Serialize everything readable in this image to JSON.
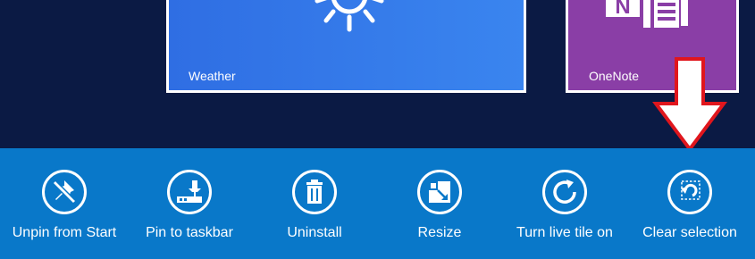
{
  "tiles": [
    {
      "label": "Weather",
      "icon": "sun-icon",
      "color": "#3a85ef"
    },
    {
      "label": "OneNote",
      "icon": "onenote-icon",
      "color": "#8a3ea6"
    }
  ],
  "app_bar": {
    "color": "#0978c9",
    "commands": [
      {
        "label": "Unpin from Start",
        "icon": "unpin-icon"
      },
      {
        "label": "Pin to taskbar",
        "icon": "pin-taskbar-icon"
      },
      {
        "label": "Uninstall",
        "icon": "trash-icon"
      },
      {
        "label": "Resize",
        "icon": "resize-icon"
      },
      {
        "label": "Turn live tile on",
        "icon": "refresh-icon"
      },
      {
        "label": "Clear selection",
        "icon": "clear-selection-icon"
      }
    ]
  },
  "annotation": {
    "type": "arrow",
    "color": "#e0161d",
    "points_to": "Clear selection"
  }
}
